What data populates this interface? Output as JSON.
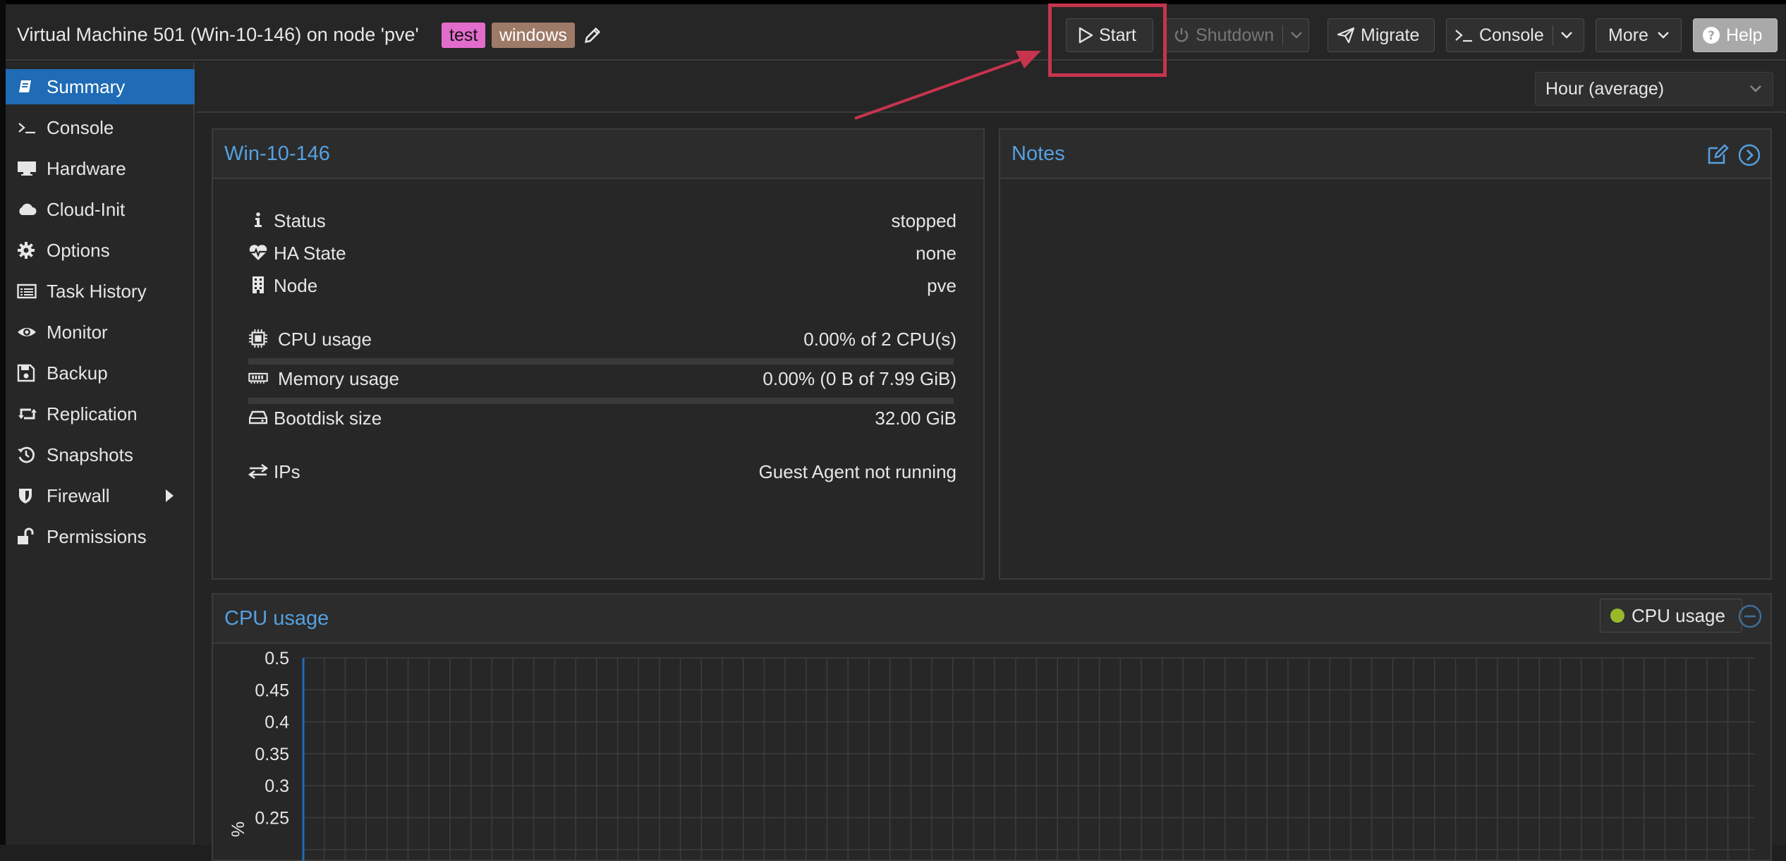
{
  "header": {
    "title": "Virtual Machine 501 (Win-10-146) on node 'pve'",
    "tags": [
      "test",
      "windows"
    ]
  },
  "toolbar": {
    "start": "Start",
    "shutdown": "Shutdown",
    "migrate": "Migrate",
    "console": "Console",
    "more": "More",
    "help": "Help"
  },
  "sidebar": {
    "items": [
      {
        "label": "Summary",
        "icon": "book-icon",
        "active": true
      },
      {
        "label": "Console",
        "icon": "terminal-icon"
      },
      {
        "label": "Hardware",
        "icon": "monitor-icon"
      },
      {
        "label": "Cloud-Init",
        "icon": "cloud-icon"
      },
      {
        "label": "Options",
        "icon": "gear-icon"
      },
      {
        "label": "Task History",
        "icon": "list-icon"
      },
      {
        "label": "Monitor",
        "icon": "eye-icon"
      },
      {
        "label": "Backup",
        "icon": "floppy-icon"
      },
      {
        "label": "Replication",
        "icon": "retweet-icon"
      },
      {
        "label": "Snapshots",
        "icon": "history-icon"
      },
      {
        "label": "Firewall",
        "icon": "shield-icon",
        "has_submenu": true
      },
      {
        "label": "Permissions",
        "icon": "unlock-icon"
      }
    ]
  },
  "timeframe": {
    "selected": "Hour (average)"
  },
  "summary": {
    "title": "Win-10-146",
    "status": {
      "label": "Status",
      "value": "stopped"
    },
    "ha_state": {
      "label": "HA State",
      "value": "none"
    },
    "node": {
      "label": "Node",
      "value": "pve"
    },
    "cpu": {
      "label": "CPU usage",
      "value": "0.00% of 2 CPU(s)",
      "fraction": 0
    },
    "memory": {
      "label": "Memory usage",
      "value": "0.00% (0 B of 7.99 GiB)",
      "fraction": 0
    },
    "bootdisk": {
      "label": "Bootdisk size",
      "value": "32.00 GiB"
    },
    "ips": {
      "label": "IPs",
      "value": "Guest Agent not running"
    }
  },
  "notes": {
    "title": "Notes"
  },
  "cpu_panel": {
    "title": "CPU usage",
    "legend": "CPU usage",
    "series_color": "#9ab82c"
  },
  "chart_data": {
    "type": "line",
    "title": "CPU usage",
    "ylabel": "%",
    "yticks": [
      "0.5",
      "0.45",
      "0.4",
      "0.35",
      "0.3",
      "0.25"
    ],
    "ylim": [
      0.25,
      0.5
    ],
    "grid": true,
    "legend": "top-right",
    "series": [
      {
        "name": "CPU usage",
        "values": []
      }
    ]
  },
  "colors": {
    "accent": "#1f6bb5",
    "title_blue": "#55a0e0",
    "annotation": "#c7344e",
    "tag_test": "#e26ccb",
    "tag_windows": "#9e7a68"
  }
}
